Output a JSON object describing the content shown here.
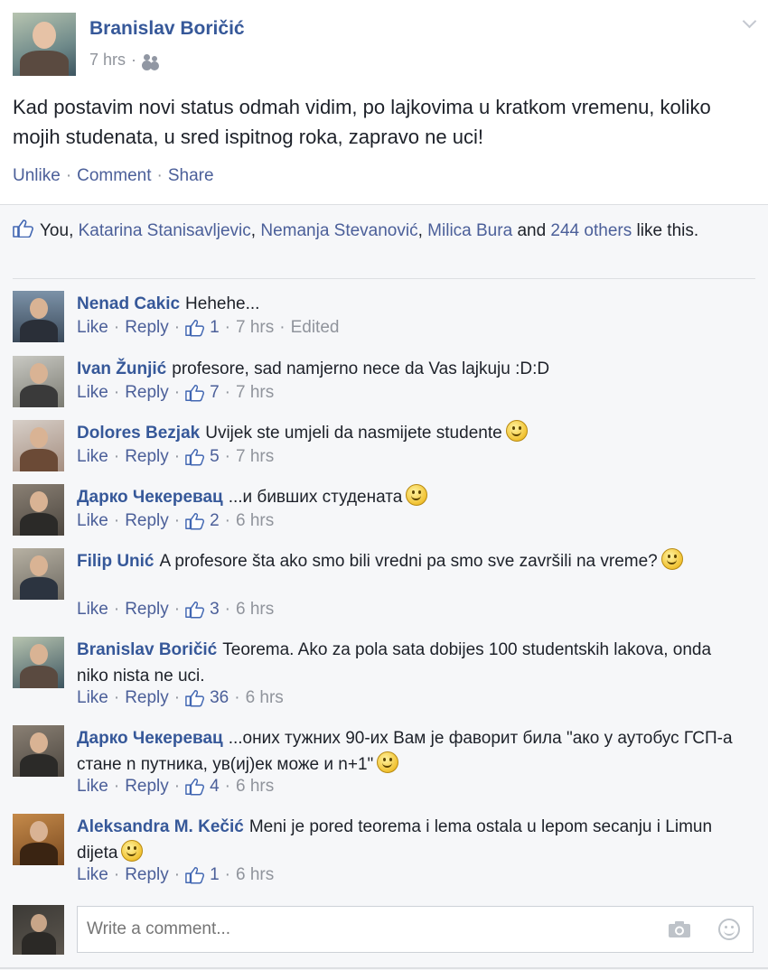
{
  "post": {
    "author": "Branislav Boričić",
    "time": "7 hrs",
    "separator": "·",
    "status": "Kad postavim novi status odmah vidim, po lajkovima u kratkom vremenu, koliko mojih studenata, u sred ispitnog roka, zapravo ne uci!",
    "actions": {
      "unlike": "Unlike",
      "comment": "Comment",
      "share": "Share"
    }
  },
  "likes": {
    "you": "You,",
    "people": [
      "Katarina Stanisavljevic",
      "Nemanja Stevanović",
      "Milica Bura"
    ],
    "and": "and",
    "others": "244 others",
    "tail": "like this."
  },
  "comments": [
    {
      "name": "Nenad Cakic",
      "text": "Hehehe...",
      "like": "Like",
      "reply": "Reply",
      "count": "1",
      "time": "7 hrs",
      "edited": "Edited",
      "emoji": false
    },
    {
      "name": "Ivan Žunjić",
      "text": "profesore, sad namjerno nece da Vas lajkuju :D:D",
      "like": "Like",
      "reply": "Reply",
      "count": "7",
      "time": "7 hrs",
      "emoji": false
    },
    {
      "name": "Dolores Bezjak",
      "text": "Uvijek ste umjeli da nasmijete studente",
      "like": "Like",
      "reply": "Reply",
      "count": "5",
      "time": "7 hrs",
      "emoji": true
    },
    {
      "name": "Дарко Чекеревац",
      "text": "...и бивших студената",
      "like": "Like",
      "reply": "Reply",
      "count": "2",
      "time": "6 hrs",
      "emoji": true
    },
    {
      "name": "Filip Unić",
      "text": "A profesore šta ako smo bili vredni pa smo sve završili na vreme?",
      "like": "Like",
      "reply": "Reply",
      "count": "3",
      "time": "6 hrs",
      "emoji": true
    },
    {
      "name": "Branislav Boričić",
      "text": "Teorema. Ako za pola sata dobijes 100 studentskih lakova, onda niko nista ne uci.",
      "like": "Like",
      "reply": "Reply",
      "count": "36",
      "time": "6 hrs",
      "emoji": false
    },
    {
      "name": "Дарко Чекеревац",
      "text": "...оних тужних 90-их Вам је фаворит била \"ако у аутобус ГСП-а стане n путника, ув(иј)ек може и n+1\"",
      "like": "Like",
      "reply": "Reply",
      "count": "4",
      "time": "6 hrs",
      "emoji": true
    },
    {
      "name": "Aleksandra M. Kečić",
      "text": "Meni je pored teorema i lema ostala u lepom secanju i Limun dijeta",
      "like": "Like",
      "reply": "Reply",
      "count": "1",
      "time": "6 hrs",
      "emoji": true
    }
  ],
  "write": {
    "placeholder": "Write a comment..."
  },
  "colors": {
    "link": "#365899",
    "muted": "#90949c",
    "ufi_bg": "#f6f7f9"
  },
  "icons": [
    "audience-icon",
    "chevron-down-icon",
    "thumbs-up-icon",
    "smiley-icon",
    "camera-icon",
    "emoji-icon"
  ]
}
